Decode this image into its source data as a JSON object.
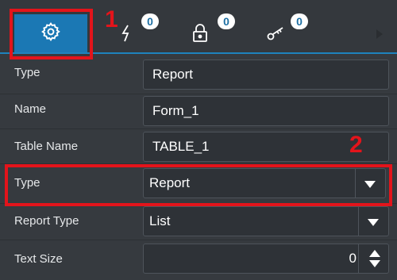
{
  "tabs": {
    "settings": {
      "icon": "gear-icon"
    },
    "events": {
      "icon": "lightning-icon",
      "badge": "0"
    },
    "permissions": {
      "icon": "lock-icon",
      "badge": "0"
    },
    "keys": {
      "icon": "key-icon",
      "badge": "0"
    }
  },
  "properties": [
    {
      "label": "Type",
      "value": "Report"
    },
    {
      "label": "Name",
      "value": "Form_1"
    },
    {
      "label": "Table Name",
      "value": "TABLE_1"
    },
    {
      "label": "Type",
      "value": "Report"
    },
    {
      "label": "Report Type",
      "value": "List"
    },
    {
      "label": "Text Size",
      "value": "0"
    }
  ],
  "annotations": {
    "step1": "1",
    "step2": "2"
  },
  "colors": {
    "accent": "#1b78b4",
    "highlight": "#e3141b",
    "background": "#363a3f"
  }
}
